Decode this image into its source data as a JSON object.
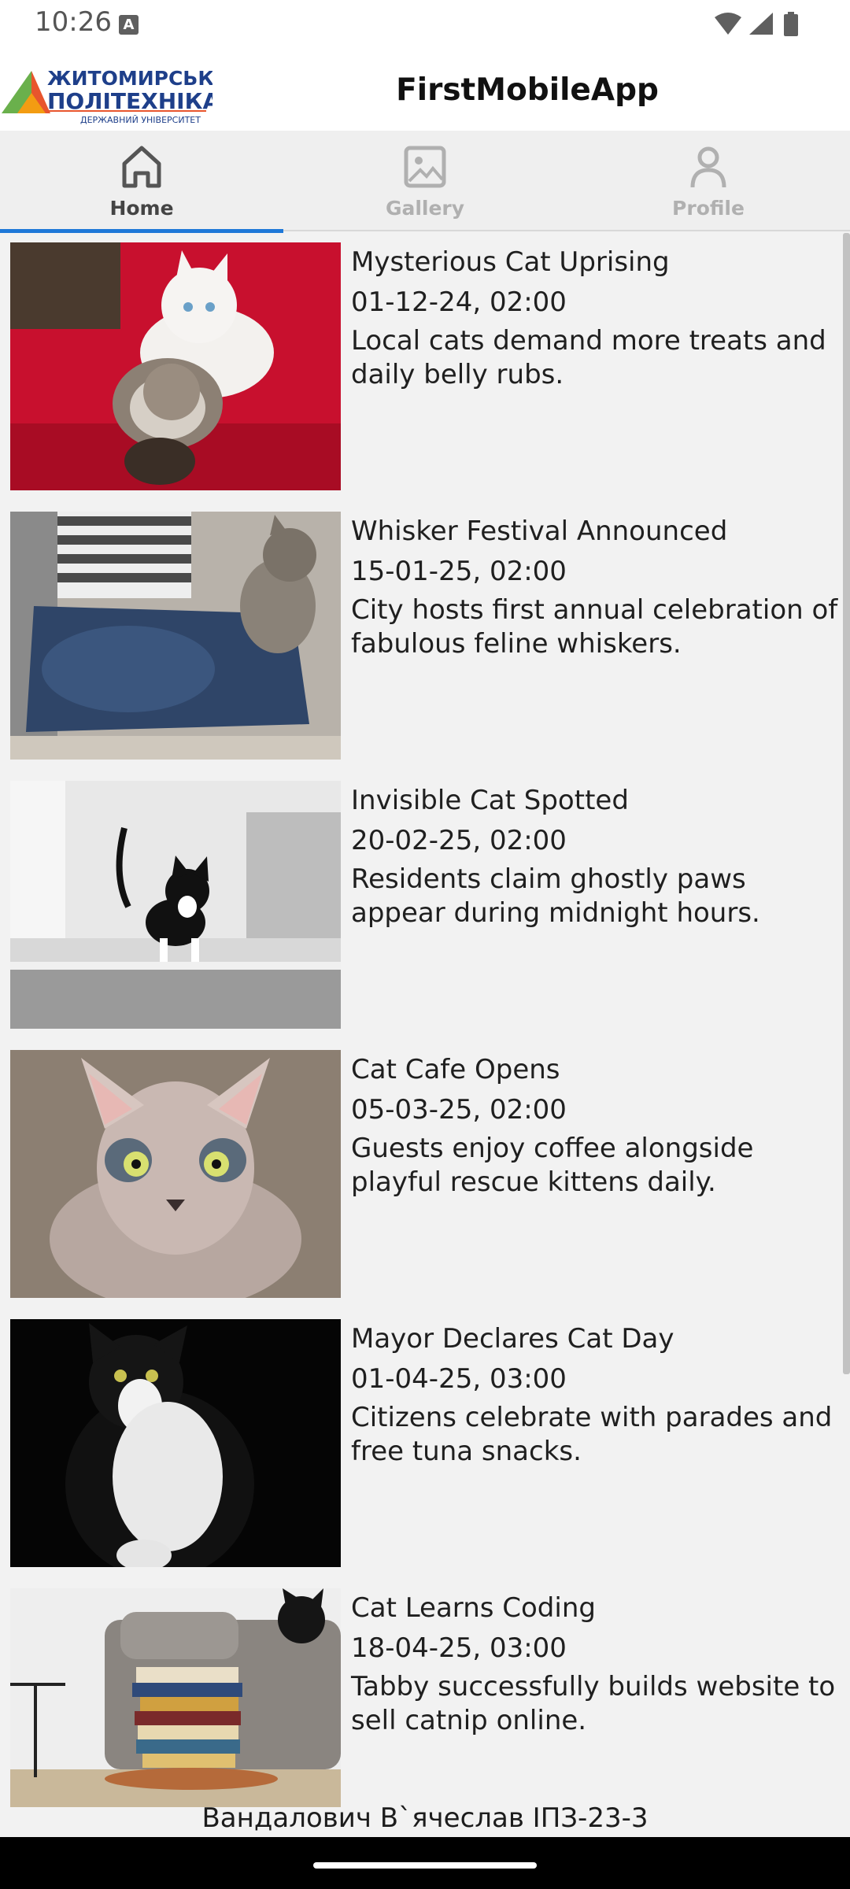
{
  "status_bar": {
    "time": "10:26",
    "notification_icon_letter": "A",
    "icons": [
      "wifi-icon",
      "signal-icon",
      "battery-icon"
    ]
  },
  "header": {
    "logo_text_line1": "ЖИТОМИРСЬКА",
    "logo_text_line2": "ПОЛІТЕХНІКА",
    "logo_text_line3": "ДЕРЖАВНИЙ УНІВЕРСИТЕТ",
    "title": "FirstMobileApp"
  },
  "tabs": [
    {
      "label": "Home",
      "icon": "home-icon",
      "active": true
    },
    {
      "label": "Gallery",
      "icon": "image-icon",
      "active": false
    },
    {
      "label": "Profile",
      "icon": "person-icon",
      "active": false
    }
  ],
  "news": [
    {
      "title": "Mysterious Cat Uprising",
      "date": "01-12-24, 02:00",
      "description": "Local cats demand more treats and daily belly rubs."
    },
    {
      "title": "Whisker Festival Announced",
      "date": "15-01-25, 02:00",
      "description": "City hosts first annual celebration of fabulous feline whiskers."
    },
    {
      "title": "Invisible Cat Spotted",
      "date": "20-02-25, 02:00",
      "description": "Residents claim ghostly paws appear during midnight hours."
    },
    {
      "title": "Cat Cafe Opens",
      "date": "05-03-25, 02:00",
      "description": "Guests enjoy coffee alongside playful rescue kittens daily."
    },
    {
      "title": "Mayor Declares Cat Day",
      "date": "01-04-25, 03:00",
      "description": "Citizens celebrate with parades and free tuna snacks."
    },
    {
      "title": "Cat Learns Coding",
      "date": "18-04-25, 03:00",
      "description": "Tabby successfully builds website to sell catnip online."
    }
  ],
  "footer": {
    "author": "Вандалович В`ячеслав ІПЗ-23-3"
  },
  "colors": {
    "accent": "#1e78d8",
    "background": "#f2f2f2",
    "tab_inactive": "#b0b0b0"
  }
}
